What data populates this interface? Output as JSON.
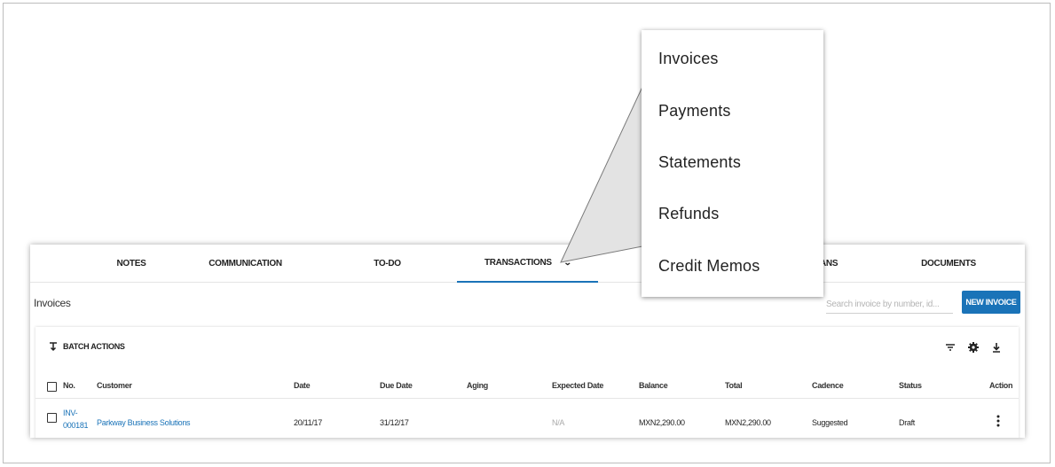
{
  "tabs": [
    {
      "label": "NOTES"
    },
    {
      "label": "COMMUNICATION"
    },
    {
      "label": "TO-DO"
    },
    {
      "label": "TRANSACTIONS",
      "active": true
    },
    {
      "label": "ANS"
    },
    {
      "label": "DOCUMENTS"
    }
  ],
  "page": {
    "title": "Invoices",
    "search_placeholder": "Search invoice by number, id...",
    "new_invoice_label": "NEW INVOICE"
  },
  "table": {
    "batch_actions_label": "BATCH ACTIONS",
    "columns": [
      "No.",
      "Customer",
      "Date",
      "Due Date",
      "Aging",
      "Expected Date",
      "Balance",
      "Total",
      "Cadence",
      "Status",
      "Action"
    ],
    "rows": [
      {
        "number_line1": "INV-",
        "number_line2": "000181",
        "customer": "Parkway Business Solutions",
        "date": "20/11/17",
        "due_date": "31/12/17",
        "aging": "",
        "expected_date": "N/A",
        "balance": "MXN2,290.00",
        "total": "MXN2,290.00",
        "cadence": "Suggested",
        "status": "Draft"
      }
    ]
  },
  "dropdown": {
    "items": [
      "Invoices",
      "Payments",
      "Statements",
      "Refunds",
      "Credit Memos"
    ]
  },
  "colors": {
    "accent": "#1a73b8",
    "callout_fill": "#e3e3e3"
  },
  "icons": [
    "batch-actions-icon",
    "filter-icon",
    "gear-icon",
    "download-icon",
    "chevron-down-icon",
    "more-vert-icon"
  ]
}
